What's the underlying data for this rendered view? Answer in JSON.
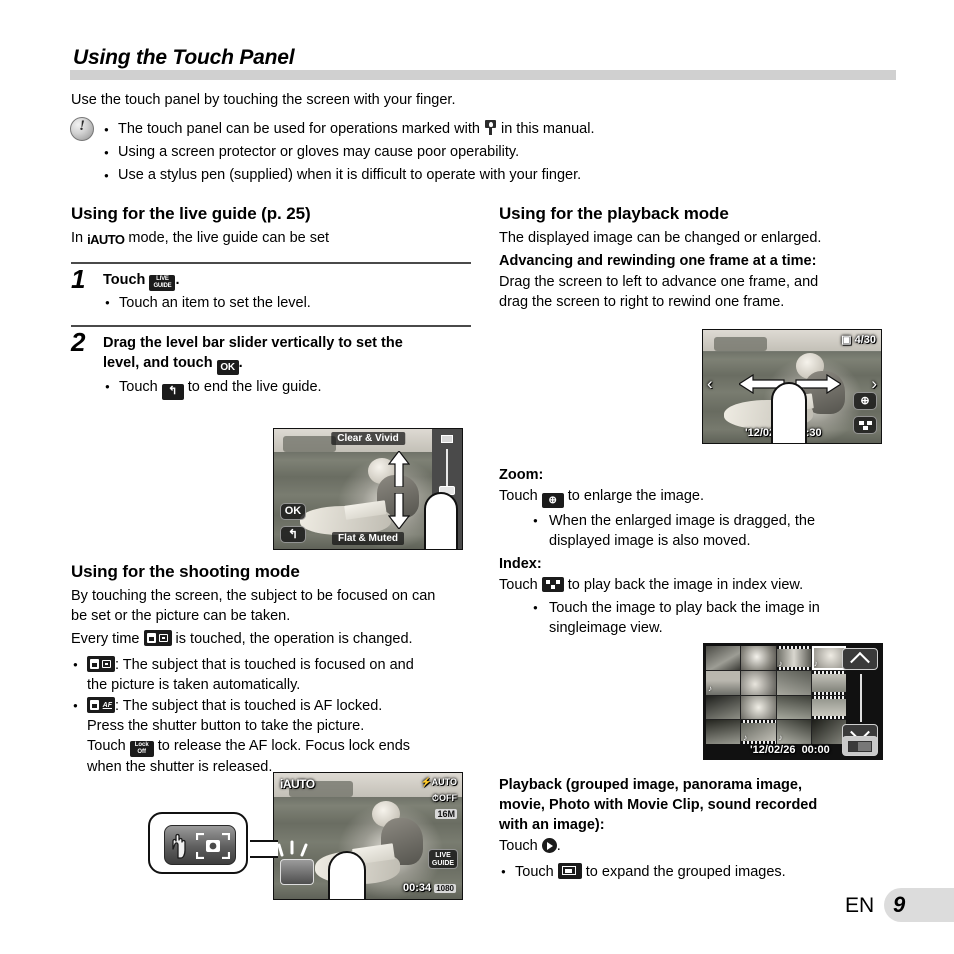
{
  "header": {
    "title": "Using the Touch Panel"
  },
  "intro": {
    "text": "Use the touch panel by touching the screen with your finger."
  },
  "notes": {
    "icon": "caution-icon",
    "items": [
      {
        "pre": "The touch panel can be used for operations marked with ",
        "icon": "touch-panel-icon",
        "post": " in this manual."
      },
      {
        "pre": "Using a screen protector or gloves may cause poor operability.",
        "icon": "",
        "post": ""
      },
      {
        "pre": "Use a stylus pen (supplied) when it is difficult to operate with your finger.",
        "icon": "",
        "post": ""
      }
    ]
  },
  "left_column": {
    "live_guide": {
      "heading": "Using for the live guide (p. 25)",
      "intro_pre": "In ",
      "mode_icon_label": "iAUTO",
      "intro_post": " mode, the live guide can be set",
      "step1": {
        "number": "1",
        "title_pre": "Touch ",
        "title_icon": "LIVE GUIDE",
        "title_icon_line1": "LIVE",
        "title_icon_line2": "GUIDE",
        "title_post": ".",
        "bullets": [
          "Touch an item to set the level."
        ]
      },
      "step2": {
        "number": "2",
        "title_line1": "Drag the level bar slider vertically to set the",
        "title_line2_pre": "level, and touch ",
        "title_icon": "OK",
        "title_line2_post": ".",
        "bullet_pre": "Touch ",
        "bullet_icon": "back-arrow",
        "bullet_post": " to end the live guide."
      },
      "screen": {
        "top_label": "Clear & Vivid",
        "bottom_label": "Flat & Muted",
        "ok_button": "OK",
        "back_button": "back-arrow"
      }
    },
    "shooting_mode": {
      "heading": "Using for the shooting mode",
      "paragraph1_line1": "By touching the screen, the subject to be focused on can",
      "paragraph1_line2": "be set or the picture can be taken.",
      "paragraph2_pre": "Every time ",
      "paragraph2_icon": "touch-shutter-icon",
      "paragraph2_post": " is touched, the operation is changed.",
      "bullets": [
        {
          "icon": "touch-shutter-icon",
          "lines": [
            ": The subject that is touched is focused on and",
            "the picture is taken automatically."
          ]
        },
        {
          "icon": "touch-af-icon",
          "lines": [
            ": The subject that is touched is AF locked.",
            "Press the shutter button to take the picture.",
            "Touch |LOCK OFF| to release the AF lock. Focus lock ends",
            "when the shutter is released."
          ],
          "inline_icon": "af-lock-off-icon",
          "inline_icon_line1": "Lock",
          "inline_icon_line2": "Off"
        }
      ],
      "screen": {
        "mode_label": "iAUTO",
        "flash_label": "AUTO",
        "timer_label": "OFF",
        "size_label": "16M",
        "live_guide_button_line1": "LIVE",
        "live_guide_button_line2": "GUIDE",
        "record_time": "00:34",
        "quality_label": "1080"
      },
      "callout": {
        "icon": "touch-shutter-button-icon"
      }
    }
  },
  "right_column": {
    "playback_mode": {
      "heading": "Using for the playback mode",
      "intro": "The displayed image can be changed or enlarged.",
      "advancing_heading": "Advancing and rewinding one frame at a time:",
      "advancing_line1": "Drag the screen to left to advance one frame, and",
      "advancing_line2": "drag the screen to right to rewind one frame.",
      "screen": {
        "counter": "4/30",
        "date": "'12/02/26",
        "time": "12:30",
        "zoom_button": "magnify-icon",
        "index_button": "index-icon"
      }
    },
    "zoom": {
      "heading": "Zoom:",
      "line_pre": "Touch ",
      "line_icon": "magnify-icon",
      "line_post": " to enlarge the image.",
      "bullets": [
        "When the enlarged image is dragged, the",
        "displayed image is also moved."
      ]
    },
    "index": {
      "heading": "Index:",
      "line_pre": "Touch ",
      "line_icon": "index-icon",
      "line_post": " to play back the image in index view.",
      "bullets": [
        "Touch the image to play back the image in",
        "singleimage view."
      ],
      "screen": {
        "date": "'12/02/26",
        "time": "00:00"
      }
    },
    "playback_group": {
      "heading_line1": "Playback (grouped image, panorama image,",
      "heading_line2": "movie, Photo with Movie Clip, sound recorded",
      "heading_line3": "with an image):",
      "line_pre": "Touch ",
      "line_icon": "play-icon",
      "line_post": ".",
      "bullet_pre": "Touch ",
      "bullet_icon": "grouped-images-icon",
      "bullet_post": " to expand the grouped images."
    }
  },
  "footer": {
    "language": "EN",
    "page_number": "9"
  },
  "colors": {
    "rule": "#d0d0d0",
    "divider": "#4a4a4a",
    "footer_box": "#dcdcdc",
    "text": "#000000"
  }
}
